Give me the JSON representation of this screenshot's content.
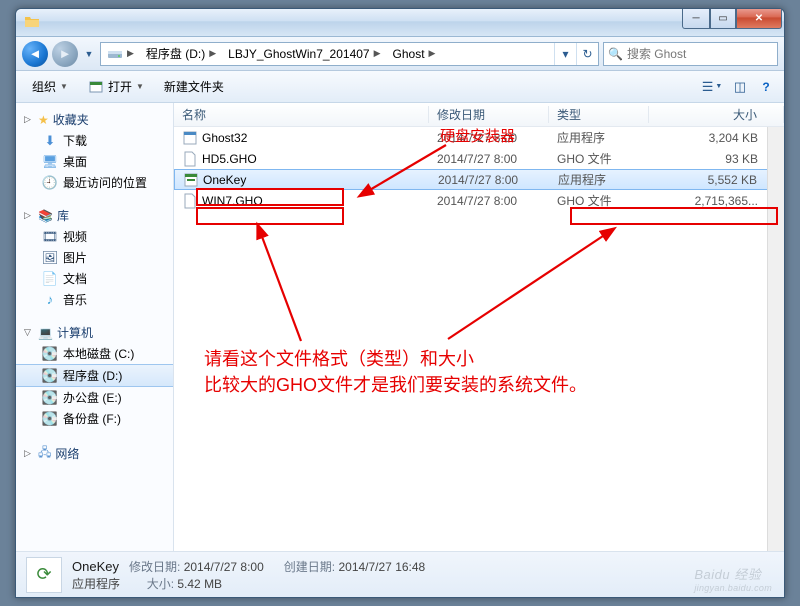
{
  "titlebar": {},
  "win_controls": {
    "min": "─",
    "max": "▭",
    "close": "✕"
  },
  "nav": {
    "dropdown": "▼"
  },
  "breadcrumbs": {
    "items": [
      {
        "label": "程序盘 (D:)"
      },
      {
        "label": "LBJY_GhostWin7_201407"
      },
      {
        "label": "Ghost"
      }
    ],
    "sep": "▶"
  },
  "search": {
    "placeholder": "搜索 Ghost"
  },
  "toolbar": {
    "organize": "组织",
    "open": "打开",
    "newfolder": "新建文件夹"
  },
  "navpane": {
    "favorites": {
      "label": "收藏夹",
      "items": [
        {
          "label": "下载"
        },
        {
          "label": "桌面"
        },
        {
          "label": "最近访问的位置"
        }
      ]
    },
    "libraries": {
      "label": "库",
      "items": [
        {
          "label": "视频"
        },
        {
          "label": "图片"
        },
        {
          "label": "文档"
        },
        {
          "label": "音乐"
        }
      ]
    },
    "computer": {
      "label": "计算机",
      "items": [
        {
          "label": "本地磁盘 (C:)"
        },
        {
          "label": "程序盘 (D:)"
        },
        {
          "label": "办公盘 (E:)"
        },
        {
          "label": "备份盘 (F:)"
        }
      ]
    },
    "network": {
      "label": "网络"
    }
  },
  "columns": {
    "name": "名称",
    "date": "修改日期",
    "type": "类型",
    "size": "大小"
  },
  "files": [
    {
      "name": "Ghost32",
      "date": "2014/7/27 8:00",
      "type": "应用程序",
      "size": "3,204 KB"
    },
    {
      "name": "HD5.GHO",
      "date": "2014/7/27 8:00",
      "type": "GHO 文件",
      "size": "93 KB"
    },
    {
      "name": "OneKey",
      "date": "2014/7/27 8:00",
      "type": "应用程序",
      "size": "5,552 KB"
    },
    {
      "name": "WIN7.GHO",
      "date": "2014/7/27 8:00",
      "type": "GHO 文件",
      "size": "2,715,365..."
    }
  ],
  "details": {
    "name": "OneKey",
    "mod_label": "修改日期:",
    "mod_value": "2014/7/27 8:00",
    "type_label": "",
    "type_value": "应用程序",
    "size_label": "大小:",
    "size_value": "5.42 MB",
    "created_label": "创建日期:",
    "created_value": "2014/7/27 16:48"
  },
  "annotations": {
    "title1": "硬盘安装器",
    "body1": "请看这个文件格式（类型）和大小",
    "body2": "比较大的GHO文件才是我们要安装的系统文件。"
  },
  "watermark": {
    "main": "Baidu 经验",
    "sub": "jingyan.baidu.com"
  }
}
